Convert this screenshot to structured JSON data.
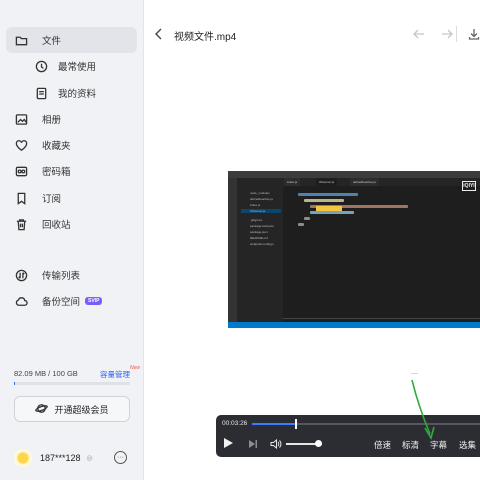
{
  "sidebar": {
    "items": [
      {
        "label": "文件",
        "icon": "folder-icon"
      },
      {
        "label": "最常使用",
        "icon": "clock-icon"
      },
      {
        "label": "我的资料",
        "icon": "document-icon"
      },
      {
        "label": "相册",
        "icon": "photo-icon"
      },
      {
        "label": "收藏夹",
        "icon": "heart-icon"
      },
      {
        "label": "密码箱",
        "icon": "safe-icon"
      },
      {
        "label": "订阅",
        "icon": "bookmark-icon"
      },
      {
        "label": "回收站",
        "icon": "trash-icon"
      },
      {
        "label": "传输列表",
        "icon": "transfer-icon"
      },
      {
        "label": "备份空间",
        "icon": "cloud-icon",
        "badge": "SVIP"
      }
    ],
    "storage": {
      "text": "82.09 MB / 100 GB",
      "link": "容量管理",
      "badge": "New",
      "used_fraction": 0.0008
    },
    "vip_button": "开通超级会员",
    "user": {
      "name": "187***128"
    }
  },
  "header": {
    "title": "视频文件.mp4"
  },
  "video": {
    "explorer_files": [
      "node_modules",
      "defineReactive.js",
      "index.js",
      "Observer.js",
      ".gitignore",
      "package-lock.json",
      "package.json",
      "README.md",
      "webpack.config.js"
    ],
    "tabs": [
      "index.js",
      "Observer.js",
      "defineReactive.js"
    ],
    "watermark": "iQIYI"
  },
  "player": {
    "time": "00:03:26",
    "progress_fraction": 0.19,
    "volume_fraction": 0.9,
    "buttons": [
      "倍速",
      "标清",
      "字幕",
      "选集"
    ]
  },
  "colors": {
    "accent": "#2b63f5",
    "player_bg": "#2c2d33",
    "arrow": "#2faa3c"
  }
}
